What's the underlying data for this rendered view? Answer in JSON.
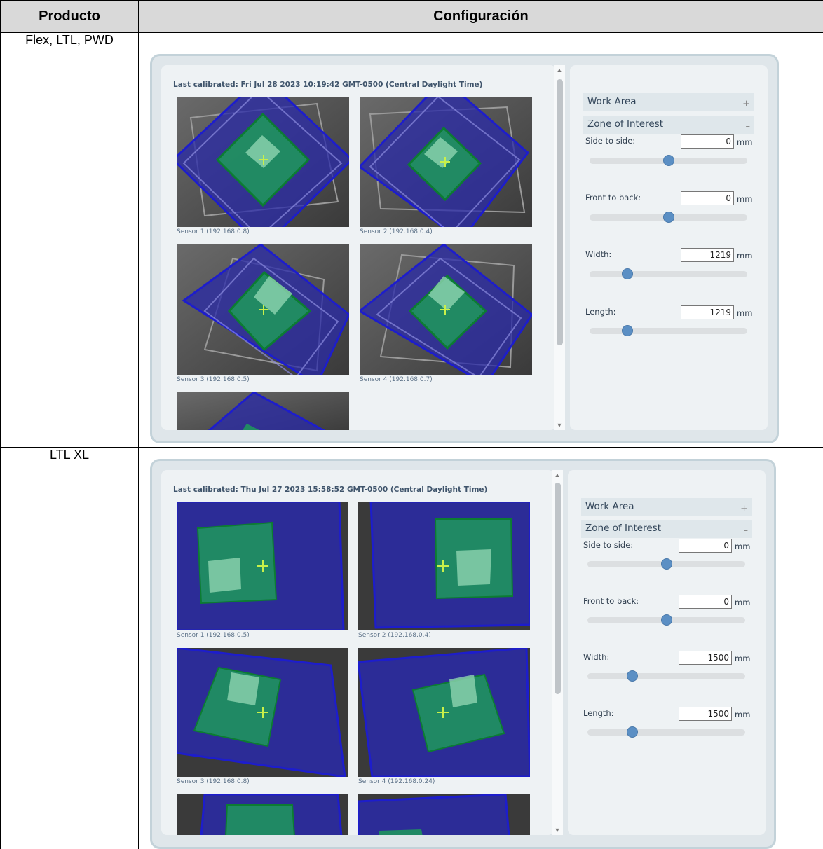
{
  "table": {
    "col_product": "Producto",
    "col_config": "Configuración"
  },
  "rows": [
    {
      "product": "Flex, LTL, PWD",
      "calibrated": "Last calibrated: Fri Jul 28 2023 10:19:42 GMT-0500 (Central Daylight Time)",
      "sensors": [
        "Sensor 1 (192.168.0.8)",
        "Sensor 2 (192.168.0.4)",
        "Sensor 3 (192.168.0.5)",
        "Sensor 4 (192.168.0.7)"
      ],
      "panel": {
        "work_area": "Work Area",
        "work_area_sign": "+",
        "zone": "Zone of Interest",
        "zone_sign": "–",
        "fields": [
          {
            "label": "Side to side:",
            "value": "0",
            "unit": "mm",
            "level": 0.5
          },
          {
            "label": "Front to back:",
            "value": "0",
            "unit": "mm",
            "level": 0.5
          },
          {
            "label": "Width:",
            "value": "1219",
            "unit": "mm",
            "level": 0.22
          },
          {
            "label": "Length:",
            "value": "1219",
            "unit": "mm",
            "level": 0.22
          }
        ]
      }
    },
    {
      "product": "LTL XL",
      "calibrated": "Last calibrated: Thu Jul 27 2023 15:58:52 GMT-0500 (Central Daylight Time)",
      "sensors": [
        "Sensor 1 (192.168.0.5)",
        "Sensor 2 (192.168.0.4)",
        "Sensor 3 (192.168.0.8)",
        "Sensor 4 (192.168.0.24)"
      ],
      "panel": {
        "work_area": "Work Area",
        "work_area_sign": "+",
        "zone": "Zone of Interest",
        "zone_sign": "–",
        "fields": [
          {
            "label": "Side to side:",
            "value": "0",
            "unit": "mm",
            "level": 0.5
          },
          {
            "label": "Front to back:",
            "value": "0",
            "unit": "mm",
            "level": 0.5
          },
          {
            "label": "Width:",
            "value": "1500",
            "unit": "mm",
            "level": 0.27
          },
          {
            "label": "Length:",
            "value": "1500",
            "unit": "mm",
            "level": 0.27
          }
        ]
      }
    }
  ],
  "colors": {
    "blue_area": "#2a2aa8",
    "green_zone": "#1f9a5a",
    "cross": "#c8f04a"
  }
}
